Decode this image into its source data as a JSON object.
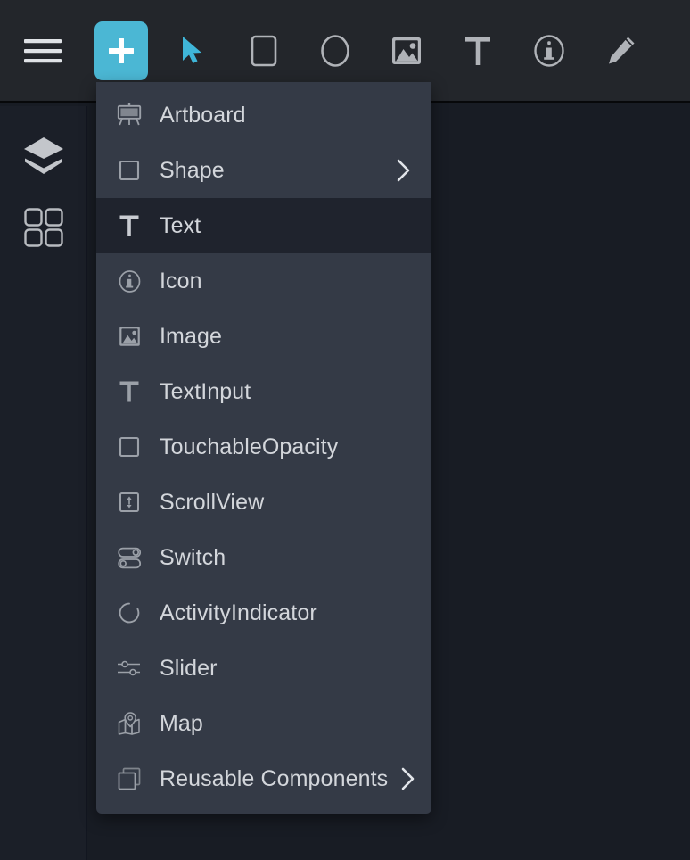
{
  "toolbar": {
    "tools": [
      {
        "name": "menu-icon",
        "label": "Menu",
        "active": false
      },
      {
        "name": "add-icon",
        "label": "Add",
        "active": true
      },
      {
        "name": "cursor-icon",
        "label": "Select",
        "active": true
      },
      {
        "name": "rectangle-icon",
        "label": "Rectangle",
        "active": false
      },
      {
        "name": "ellipse-icon",
        "label": "Ellipse",
        "active": false
      },
      {
        "name": "image-icon",
        "label": "Image",
        "active": false
      },
      {
        "name": "text-icon",
        "label": "Text",
        "active": false
      },
      {
        "name": "info-icon",
        "label": "Info",
        "active": false
      },
      {
        "name": "pencil-icon",
        "label": "Edit",
        "active": false
      }
    ],
    "accent_color": "#4bb7d4",
    "icon_color": "#b0b3b8",
    "background": "#23262b"
  },
  "sidebar": {
    "items": [
      {
        "name": "layers-icon",
        "label": "Layers"
      },
      {
        "name": "components-grid-icon",
        "label": "Components"
      }
    ],
    "background": "#1b1f28"
  },
  "canvas": {
    "background": "#181c24"
  },
  "add_menu": {
    "background": "#343a46",
    "selected_background": "#1f232d",
    "items": [
      {
        "icon": "artboard-icon",
        "label": "Artboard",
        "submenu": false,
        "selected": false
      },
      {
        "icon": "square-icon",
        "label": "Shape",
        "submenu": true,
        "selected": false
      },
      {
        "icon": "text-t-icon",
        "label": "Text",
        "submenu": false,
        "selected": true
      },
      {
        "icon": "info-circle-icon",
        "label": "Icon",
        "submenu": false,
        "selected": false
      },
      {
        "icon": "image-icon",
        "label": "Image",
        "submenu": false,
        "selected": false
      },
      {
        "icon": "text-t-icon",
        "label": "TextInput",
        "submenu": false,
        "selected": false
      },
      {
        "icon": "square-icon",
        "label": "TouchableOpacity",
        "submenu": false,
        "selected": false
      },
      {
        "icon": "scrollview-icon",
        "label": "ScrollView",
        "submenu": false,
        "selected": false
      },
      {
        "icon": "switch-icon",
        "label": "Switch",
        "submenu": false,
        "selected": false
      },
      {
        "icon": "spinner-icon",
        "label": "ActivityIndicator",
        "submenu": false,
        "selected": false
      },
      {
        "icon": "slider-icon",
        "label": "Slider",
        "submenu": false,
        "selected": false
      },
      {
        "icon": "map-pin-icon",
        "label": "Map",
        "submenu": false,
        "selected": false
      },
      {
        "icon": "copy-squares-icon",
        "label": "Reusable Components",
        "submenu": true,
        "selected": false
      }
    ]
  }
}
